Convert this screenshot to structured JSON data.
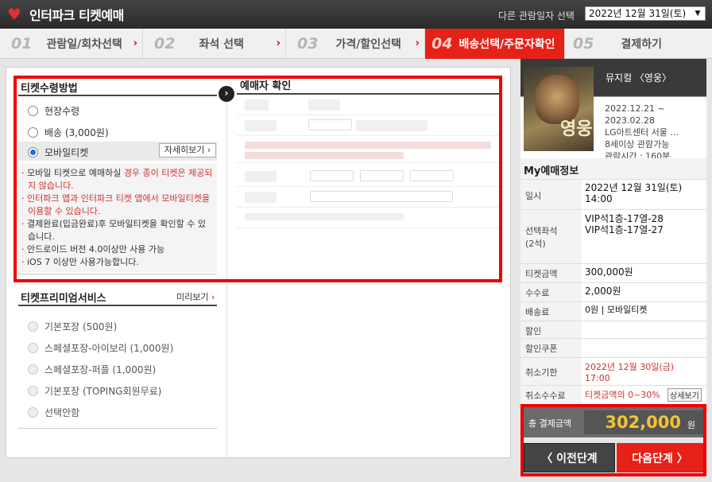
{
  "header": {
    "logo_text": "인터파크 티켓예매",
    "date_label": "다른 관람일자 선택",
    "date_selected": "2022년 12월 31일(토)"
  },
  "steps": [
    {
      "num": "01",
      "label": "관람일/회차선택"
    },
    {
      "num": "02",
      "label": "좌석 선택"
    },
    {
      "num": "03",
      "label": "가격/할인선택"
    },
    {
      "num": "04",
      "label": "배송선택/주문자확인"
    },
    {
      "num": "05",
      "label": "결제하기"
    }
  ],
  "receive": {
    "title": "티켓수령방법",
    "options": [
      "현장수령",
      "배송 (3,000원)",
      "모바일티켓"
    ],
    "selected": "모바일티켓",
    "detail_button": "자세히보기",
    "notes": [
      {
        "a": "모바일 티켓으로 예매하실 ",
        "b": "경우 종이 티켓은 제공되지 않습니다."
      },
      {
        "a": "",
        "b": "인터파크 앱과 인터파크 티켓 앱에서 모바일티켓을 이용할 수 있습니다."
      },
      {
        "a": "결제완료(입금완료)후 모바일티켓을 확인할 수 있습니다.",
        "b": ""
      },
      {
        "a": "안드로이드 버전 4.0이상만 사용 가능",
        "b": ""
      },
      {
        "a": "iOS 7 이상만 사용가능합니다.",
        "b": ""
      }
    ]
  },
  "booker": {
    "title": "예매자 확인"
  },
  "premium": {
    "title": "티켓프리미엄서비스",
    "preview": "미리보기",
    "options": [
      "기본포장 (500원)",
      "스페셜포장-아이보리 (1,000원)",
      "스페셜포장-퍼플 (1,000원)",
      "기본포장 (TOPING회원무료)",
      "선택안함"
    ]
  },
  "show": {
    "title": "뮤지컬 〈영웅〉",
    "poster_text": "영웅",
    "period": "2022.12.21 ~ 2023.02.28",
    "venue": "LG아트센터 서울 ...",
    "age": "8세이상 관람가능",
    "runtime": "관람시간 : 160분"
  },
  "my_info": {
    "title": "My예매정보",
    "rows": [
      {
        "k": "일시",
        "v": "2022년 12월 31일(토)\n14:00"
      },
      {
        "k": "선택좌석\n(2석)",
        "v": "VIP석1층-17열-28\nVIP석1층-17열-27"
      },
      {
        "k": "티켓금액",
        "v": "300,000원"
      },
      {
        "k": "수수료",
        "v": "2,000원"
      },
      {
        "k": "배송료",
        "v": "0원 | 모바일티켓"
      },
      {
        "k": "할인",
        "v": ""
      },
      {
        "k": "할인쿠폰",
        "v": ""
      },
      {
        "k": "취소기한",
        "v": "2022년 12월 30일(금)\n17:00"
      },
      {
        "k": "취소수수료",
        "v": "티켓금액의 0~30%"
      }
    ],
    "detail_btn": "상세보기"
  },
  "total": {
    "label": "총 결제금액",
    "amount": "302,000",
    "unit": "원"
  },
  "buttons": {
    "prev": "〈  이전단계",
    "next": "다음단계  〉"
  }
}
